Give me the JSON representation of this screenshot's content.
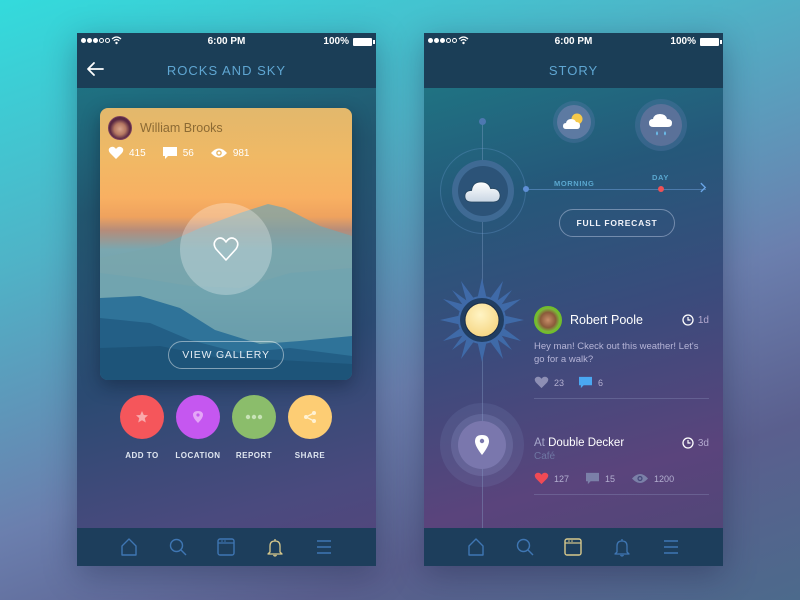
{
  "status_bar": {
    "time": "6:00 PM",
    "battery": "100%"
  },
  "left_screen": {
    "title": "ROCKS AND SKY",
    "card": {
      "author": "William Brooks",
      "likes": "415",
      "comments": "56",
      "views": "981",
      "view_gallery_label": "VIEW GALLERY"
    },
    "actions": [
      {
        "label": "ADD TO",
        "icon": "star-icon",
        "color": "#f5565b"
      },
      {
        "label": "LOCATION",
        "icon": "location-pin-icon",
        "color": "#c557f0"
      },
      {
        "label": "REPORT",
        "icon": "more-dots-icon",
        "color": "#8bbd6b"
      },
      {
        "label": "SHARE",
        "icon": "share-icon",
        "color": "#fdcd74"
      }
    ],
    "tabbar": [
      "home-icon",
      "search-icon",
      "calendar-icon",
      "bell-icon",
      "menu-icon"
    ],
    "active_tab": "bell-icon"
  },
  "right_screen": {
    "title": "STORY",
    "forecast": {
      "morning_label": "MORNING",
      "day_label": "DAY",
      "full_forecast_label": "FULL FORECAST",
      "icons": [
        "partly-sunny-icon",
        "rain-cloud-icon",
        "cloud-icon"
      ]
    },
    "post": {
      "author": "Robert Poole",
      "time": "1d",
      "text": "Hey man! Ckeck out this weather! Let's go for a walk?",
      "likes": "23",
      "comments": "6"
    },
    "checkin": {
      "prefix": "At",
      "place": "Double Decker",
      "category": "Café",
      "time": "3d",
      "likes": "127",
      "comments": "15",
      "views": "1200"
    },
    "tabbar": [
      "home-icon",
      "search-icon",
      "calendar-icon",
      "bell-icon",
      "menu-icon"
    ],
    "active_tab": "calendar-icon"
  },
  "colors": {
    "accent_blue": "#5fa6d2",
    "active_tab": "#d8c98c",
    "like_red": "#f04a55",
    "comment_blue": "#4aa8f2"
  }
}
